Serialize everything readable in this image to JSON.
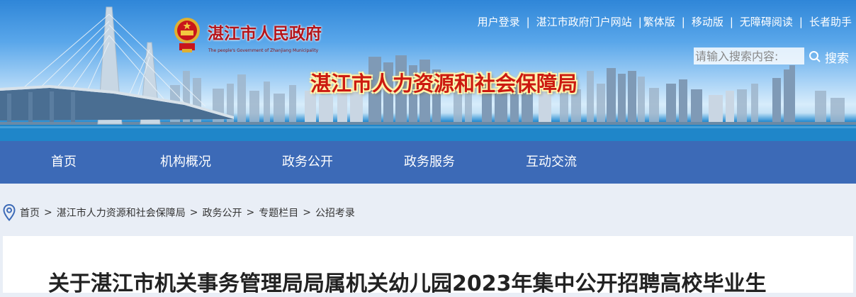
{
  "header": {
    "site_name": "湛江市人民政府",
    "site_name_en": "The people's Government of Zhanjiang Municipality",
    "bureau_title": "湛江市人力资源和社会保障局",
    "top_links": [
      "用户登录",
      "湛江市政府门户网站",
      "繁体版",
      "移动版",
      "无障碍阅读",
      "长者助手"
    ],
    "search": {
      "placeholder": "请输入搜索内容:",
      "button_label": "搜索"
    }
  },
  "nav": {
    "items": [
      "首页",
      "机构概况",
      "政务公开",
      "政务服务",
      "互动交流"
    ]
  },
  "breadcrumb": [
    "首页",
    "湛江市人力资源和社会保障局",
    "政务公开",
    "专题栏目",
    "公招考录"
  ],
  "article": {
    "title": "关于湛江市机关事务管理局局属机关幼儿园2023年集中公开招聘高校毕业生"
  },
  "colors": {
    "nav_bg": "#3c6ab7",
    "title_red": "#cc1a10",
    "page_bg": "#e9eef6"
  }
}
